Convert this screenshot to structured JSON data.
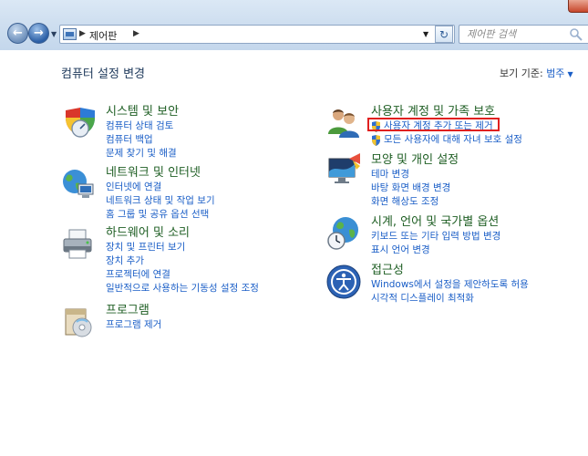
{
  "address": {
    "breadcrumb": "제어판",
    "search_placeholder": "제어판 검색"
  },
  "header": {
    "title": "컴퓨터 설정 변경",
    "view_by_label": "보기 기준:",
    "view_by_value": "범주"
  },
  "left_categories": [
    {
      "title": "시스템 및 보안",
      "links": [
        "컴퓨터 상태 검토",
        "컴퓨터 백업",
        "문제 찾기 및 해결"
      ]
    },
    {
      "title": "네트워크 및 인터넷",
      "links": [
        "인터넷에 연결",
        "네트워크 상태 및 작업 보기",
        "홈 그룹 및 공유 옵션 선택"
      ]
    },
    {
      "title": "하드웨어 및 소리",
      "links": [
        "장치 및 프린터 보기",
        "장치 추가",
        "프로젝터에 연결",
        "일반적으로 사용하는 기동성 설정 조정"
      ]
    },
    {
      "title": "프로그램",
      "links": [
        "프로그램 제거"
      ]
    }
  ],
  "right_categories": [
    {
      "title": "사용자 계정 및 가족 보호",
      "links": [
        "사용자 계정 추가 또는 제거",
        "모든 사용자에 대해 자녀 보호 설정"
      ]
    },
    {
      "title": "모양 및 개인 설정",
      "links": [
        "테마 변경",
        "바탕 화면 배경 변경",
        "화면 해상도 조정"
      ]
    },
    {
      "title": "시계, 언어 및 국가별 옵션",
      "links": [
        "키보드 또는 기타 입력 방법 변경",
        "표시 언어 변경"
      ]
    },
    {
      "title": "접근성",
      "links": [
        "Windows에서 설정을 제안하도록 허용",
        "시각적 디스플레이 최적화"
      ]
    }
  ],
  "icons": {
    "back": "back-arrow-icon",
    "forward": "forward-arrow-icon",
    "refresh": "refresh-icon",
    "search": "search-icon",
    "uac_shield": "uac-shield-icon"
  },
  "colors": {
    "link": "#1a5ec7",
    "category_title": "#1e5e23",
    "highlight": "#e0201f"
  }
}
